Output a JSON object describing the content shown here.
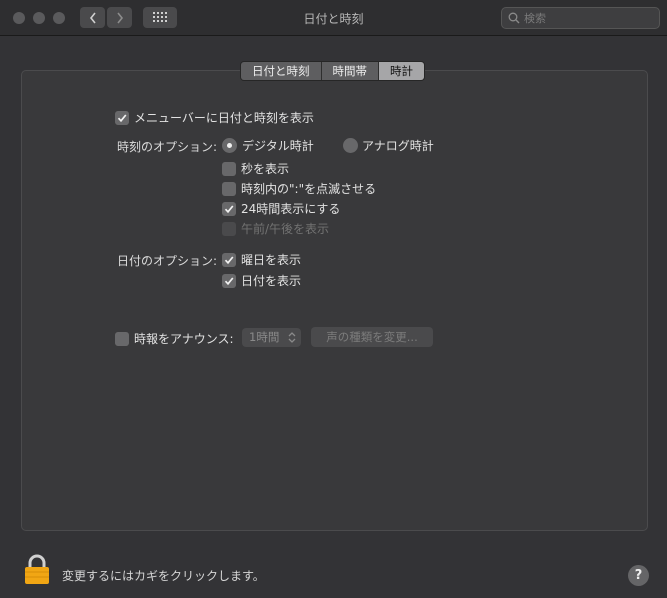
{
  "window": {
    "title": "日付と時刻",
    "search_placeholder": "検索"
  },
  "tabs": [
    {
      "label": "日付と時刻",
      "active": false
    },
    {
      "label": "時間帯",
      "active": false
    },
    {
      "label": "時計",
      "active": true
    }
  ],
  "clock": {
    "show_in_menubar": {
      "label": "メニューバーに日付と時刻を表示",
      "checked": true
    },
    "time_options_label": "時刻のオプション:",
    "digital": {
      "label": "デジタル時計",
      "selected": true
    },
    "analog": {
      "label": "アナログ時計",
      "selected": false
    },
    "show_seconds": {
      "label": "秒を表示",
      "checked": false
    },
    "flash_separators": {
      "label": "時刻内の\":\"を点滅させる",
      "checked": false
    },
    "use_24_hour": {
      "label": "24時間表示にする",
      "checked": true
    },
    "show_ampm": {
      "label": "午前/午後を表示",
      "checked": false,
      "disabled": true
    },
    "date_options_label": "日付のオプション:",
    "show_day_of_week": {
      "label": "曜日を表示",
      "checked": true
    },
    "show_date": {
      "label": "日付を表示",
      "checked": true
    },
    "announce_time": {
      "label": "時報をアナウンス:",
      "checked": false
    },
    "interval": {
      "value": "1時間"
    },
    "customize_voice_label": "声の種類を変更..."
  },
  "footer": {
    "lock_text": "変更するにはカギをクリックします。",
    "help_label": "?"
  },
  "colors": {
    "background": "#333336",
    "panel": "#39393b",
    "active_tab": "#a6a6a8"
  }
}
